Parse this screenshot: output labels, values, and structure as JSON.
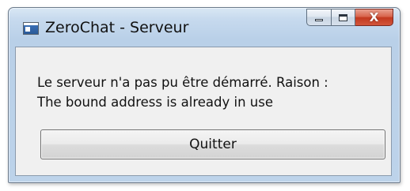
{
  "window": {
    "title": "ZeroChat - Serveur",
    "controls": {
      "minimize_icon": "minimize-icon",
      "maximize_icon": "maximize-icon",
      "close_icon": "close-icon",
      "close_glyph": "X"
    }
  },
  "message": {
    "line1": "Le serveur n'a pas pu être démarré. Raison :",
    "line2": "The bound address is already in use"
  },
  "buttons": {
    "quit_label": "Quitter"
  },
  "colors": {
    "close_button": "#c2391f",
    "frame": "#bdd3ea",
    "client_bg": "#f0f0f0"
  }
}
